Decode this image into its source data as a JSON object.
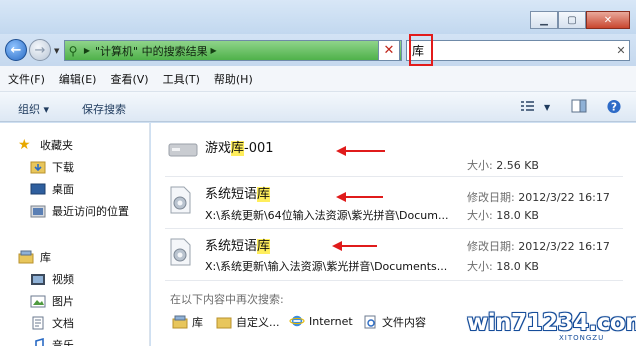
{
  "search": {
    "query": "库",
    "location_path": "\"计算机\" 中的搜索结果"
  },
  "menu": [
    "文件(F)",
    "编辑(E)",
    "查看(V)",
    "工具(T)",
    "帮助(H)"
  ],
  "toolbar": {
    "organize": "组织 ▾",
    "save_search": "保存搜索"
  },
  "nav": {
    "favorites": "收藏夹",
    "downloads": "下载",
    "desktop": "桌面",
    "recent": "最近访问的位置",
    "libraries": "库",
    "videos": "视频",
    "pictures": "图片",
    "documents": "文档",
    "music": "音乐"
  },
  "results": [
    {
      "name_before": "游戏",
      "name_match": "库",
      "name_after": "-001",
      "path": "",
      "modified_label": "",
      "modified": "",
      "size_label": "大小:",
      "size": "2.56 KB",
      "icon": "drive-icon"
    },
    {
      "name_before": "系统短语",
      "name_match": "库",
      "name_after": "",
      "path": "X:\\系统更新\\64位输入法资源\\紫光拼音\\Docum...",
      "modified_label": "修改日期:",
      "modified": "2012/3/22 16:17",
      "size_label": "大小:",
      "size": "18.0 KB",
      "icon": "system-file-icon"
    },
    {
      "name_before": "系统短语",
      "name_match": "库",
      "name_after": "",
      "path": "X:\\系统更新\\输入法资源\\紫光拼音\\Documents...",
      "modified_label": "修改日期:",
      "modified": "2012/3/22 16:17",
      "size_label": "大小:",
      "size": "18.0 KB",
      "icon": "system-file-icon"
    }
  ],
  "search_again": {
    "label": "在以下内容中再次搜索:",
    "locations": [
      "库",
      "自定义...",
      "Internet",
      "文件内容"
    ]
  },
  "watermark": {
    "text": "win71234.com",
    "sub": "XITONGZU"
  },
  "colors": {
    "highlight": "#ffee5c",
    "annotation": "#e01b1b",
    "address_bar": "#4fb14a"
  }
}
